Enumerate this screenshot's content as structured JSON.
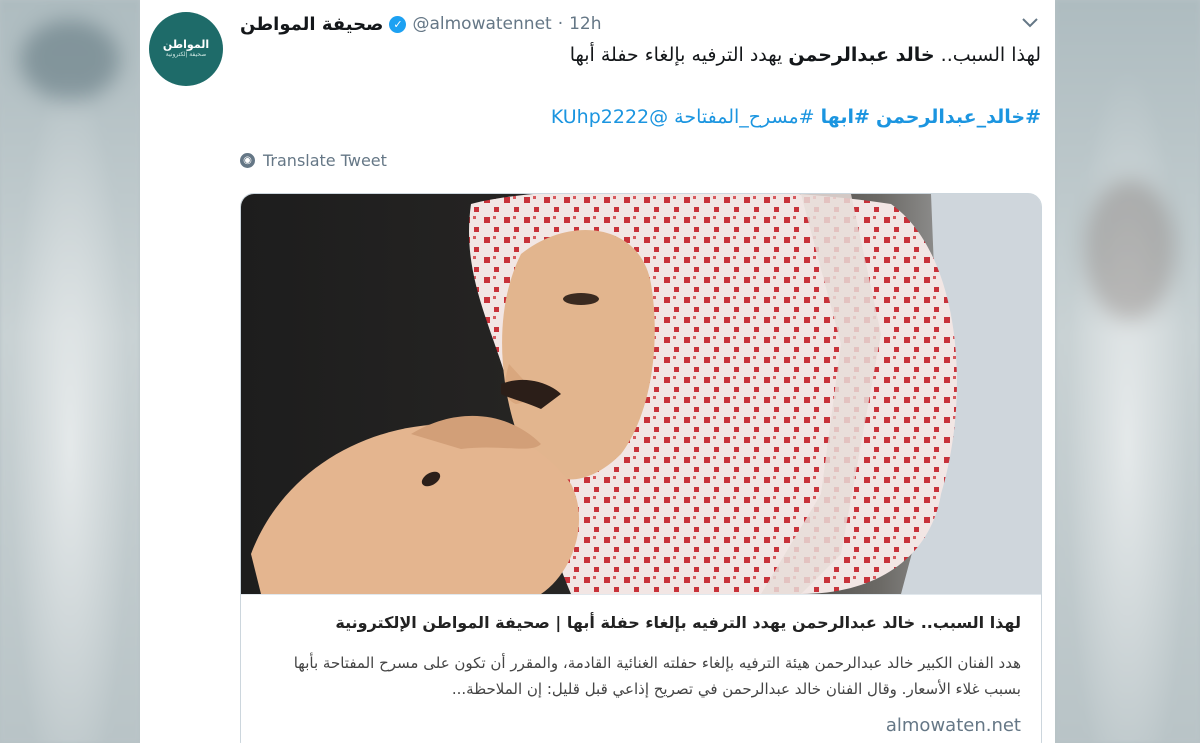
{
  "tweet": {
    "display_name": "صحيفة المواطن",
    "handle": "@almowatennet",
    "separator": "·",
    "time": "12h",
    "verified_icon": "verified-badge-icon",
    "line1_prefix": "لهذا السبب.. ",
    "line1_bold": "خالد عبدالرحمن",
    "line1_suffix": " يهدد الترفيه بإلغاء حفلة أبها",
    "hashtags": [
      "#خالد_عبدالرحمن",
      "#ابها",
      "#مسرح_المفتاحة"
    ],
    "mention": "@KUhp2222",
    "translate_label": "Translate Tweet",
    "avatar_text": "المواطن",
    "avatar_subtext": "صحيفة إلكترونية"
  },
  "link_card": {
    "title": "لهذا السبب.. خالد عبدالرحمن يهدد الترفيه بإلغاء حفلة أبها | صحيفة المواطن الإلكترونية",
    "description": "هدد الفنان الكبير خالد عبدالرحمن هيئة الترفيه بإلغاء حفلته الغنائية القادمة، والمقرر أن تكون على مسرح المفتاحة بأبها بسبب غلاء الأسعار. وقال الفنان خالد عبدالرحمن في تصريح إذاعي قبل قليل: إن الملاحظة...",
    "domain": "almowaten.net",
    "image": "portrait-photo"
  },
  "colors": {
    "link_blue": "#1b95e0",
    "verified_blue": "#1da1f2",
    "muted": "#657786",
    "avatar_bg": "#1e6b69"
  }
}
